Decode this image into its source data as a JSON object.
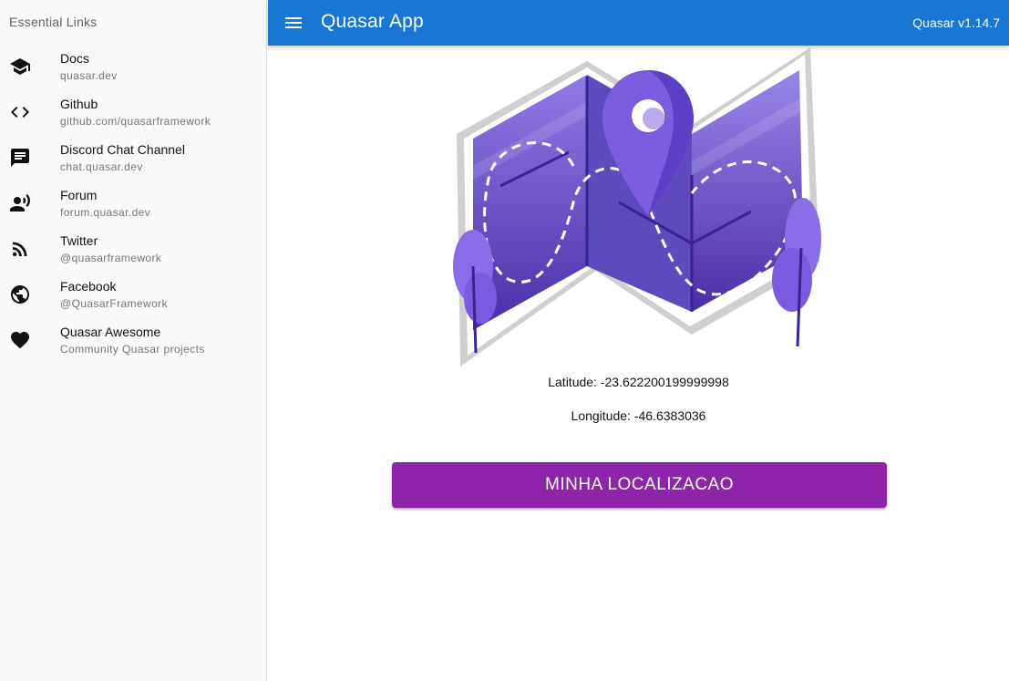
{
  "drawer": {
    "header": "Essential Links",
    "links": [
      {
        "title": "Docs",
        "caption": "quasar.dev",
        "icon": "school-icon"
      },
      {
        "title": "Github",
        "caption": "github.com/quasarframework",
        "icon": "code-icon"
      },
      {
        "title": "Discord Chat Channel",
        "caption": "chat.quasar.dev",
        "icon": "chat-icon"
      },
      {
        "title": "Forum",
        "caption": "forum.quasar.dev",
        "icon": "record-voice-icon"
      },
      {
        "title": "Twitter",
        "caption": "@quasarframework",
        "icon": "rss-feed-icon"
      },
      {
        "title": "Facebook",
        "caption": "@QuasarFramework",
        "icon": "public-icon"
      },
      {
        "title": "Quasar Awesome",
        "caption": "Community Quasar projects",
        "icon": "favorite-icon"
      }
    ]
  },
  "header": {
    "title": "Quasar App",
    "version": "Quasar v1.14.7",
    "menu_icon": "menu-icon"
  },
  "main": {
    "latitude": "Latitude: -23.622200199999998",
    "longitude": "Longitude: -46.6383036",
    "button_label": "MINHA LOCALIZACAO"
  },
  "colors": {
    "header": "#1976d2",
    "button": "#8e24aa",
    "map_purple": "#6a4fd8"
  }
}
